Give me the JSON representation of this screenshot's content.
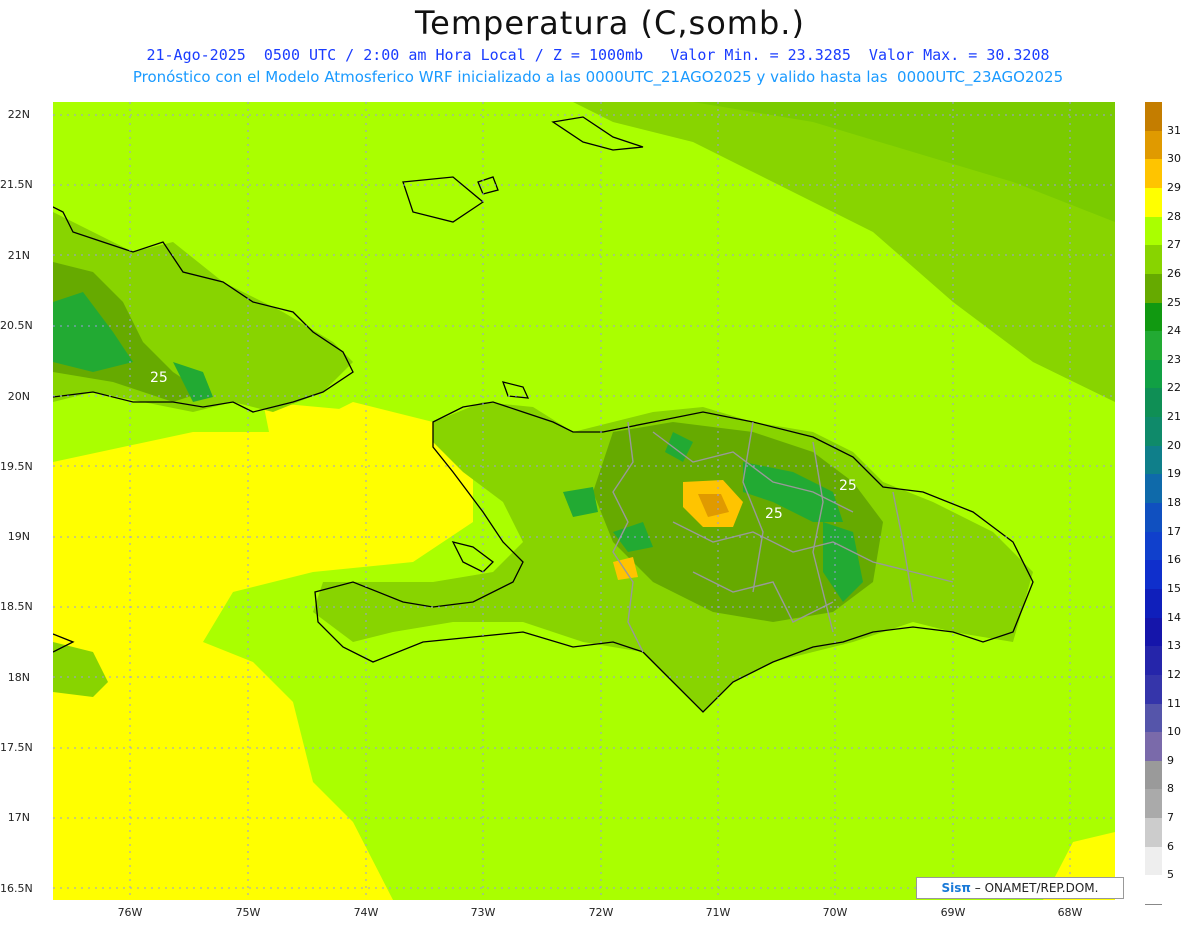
{
  "title": "Temperatura (C,somb.)",
  "subtitle_line1": "21-Ago-2025  0500 UTC / 2:00 am Hora Local / Z = 1000mb   Valor Min. = 23.3285  Valor Max. = 30.3208",
  "subtitle_line2": "Pronóstico con el Modelo Atmosferico WRF inicializado a las 0000UTC_21AGO2025 y valido hasta las  0000UTC_23AGO2025",
  "lat_labels": [
    "22N",
    "21.5N",
    "21N",
    "20.5N",
    "20N",
    "19.5N",
    "19N",
    "18.5N",
    "18N",
    "17.5N",
    "17N",
    "16.5N"
  ],
  "lon_labels": [
    "76W",
    "75W",
    "74W",
    "73W",
    "72W",
    "71W",
    "70W",
    "69W",
    "68W"
  ],
  "colorbar": {
    "labels": [
      "31",
      "30",
      "29",
      "28",
      "27",
      "26",
      "25",
      "24",
      "23",
      "22",
      "21",
      "20",
      "19",
      "18",
      "17",
      "16",
      "15",
      "14",
      "13",
      "12",
      "11",
      "10",
      "9",
      "8",
      "7",
      "6",
      "5"
    ],
    "colors": [
      "#c47d00",
      "#e09a00",
      "#ffc400",
      "#ffff00",
      "#aaff00",
      "#88d400",
      "#66aa00",
      "#119911",
      "#22aa33",
      "#11a044",
      "#0f8f55",
      "#0f8a6a",
      "#0f7f8a",
      "#0f6aaa",
      "#1050c0",
      "#1040cc",
      "#0f2fcc",
      "#0f1fbb",
      "#1515aa",
      "#2525aa",
      "#3535aa",
      "#5555aa",
      "#7a6aaa",
      "#9a9a9a",
      "#aaaaaa",
      "#cccccc",
      "#eeeeee",
      "#ffffff"
    ]
  },
  "contour_labels": [
    "25",
    "25",
    "25"
  ],
  "credit": {
    "logo": "Sisπ",
    "text": "– ONAMET/REP.DOM."
  },
  "colors": {
    "base_green": "#aaff00",
    "yellow": "#ffff00",
    "mid_green": "#88d400"
  }
}
